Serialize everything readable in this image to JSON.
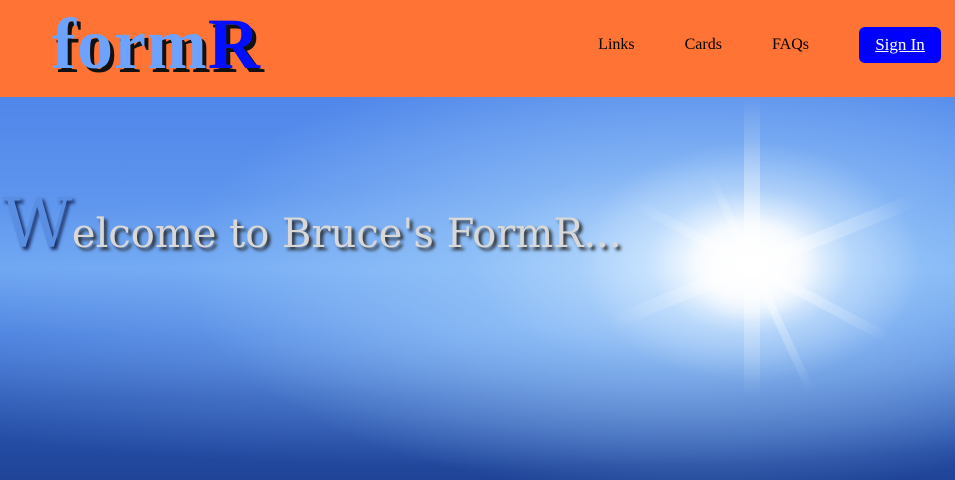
{
  "header": {
    "logo": {
      "main": "form",
      "accent": "R"
    },
    "nav": [
      {
        "label": "Links"
      },
      {
        "label": "Cards"
      },
      {
        "label": "FAQs"
      }
    ],
    "signin_label": "Sign In"
  },
  "hero": {
    "heading_first_letter": "W",
    "heading_rest": "elcome to Bruce's FormR..."
  },
  "colors": {
    "navbar": "#ff7335",
    "logo_main": "#6da3ff",
    "logo_accent": "#0010ff",
    "signin_button": "#0000ff",
    "heading_text": "#d8d8d8",
    "heading_first_letter": "#5a8ee3"
  }
}
